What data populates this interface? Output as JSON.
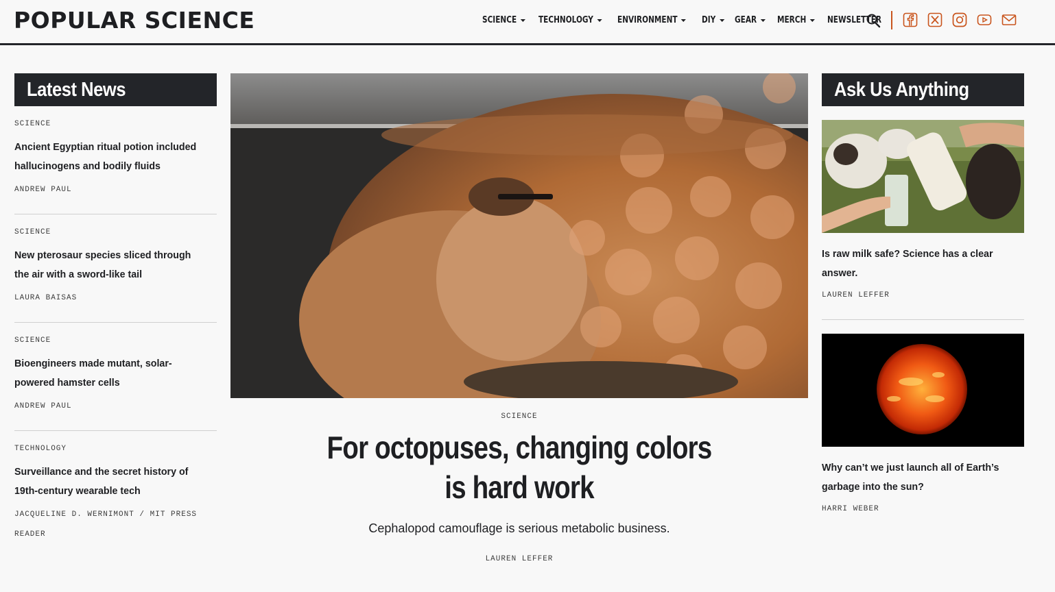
{
  "header": {
    "logo": "POPULAR SCIENCE",
    "nav": [
      {
        "label": "SCIENCE",
        "caret": true
      },
      {
        "label": "TECHNOLOGY",
        "caret": true
      },
      {
        "label": "ENVIRONMENT",
        "caret": true
      },
      {
        "label": "DIY",
        "caret": true
      },
      {
        "label": "GEAR",
        "caret": true
      },
      {
        "label": "MERCH",
        "caret": true
      },
      {
        "label": "NEWSLETTER",
        "caret": false
      }
    ],
    "icons": [
      "search-icon",
      "facebook-icon",
      "x-icon",
      "instagram-icon",
      "youtube-icon",
      "mail-icon"
    ],
    "accent": "#c9541c"
  },
  "latest": {
    "title": "Latest News",
    "items": [
      {
        "category": "SCIENCE",
        "headline": "Ancient Egyptian ritual potion included hallucinogens and bodily fluids",
        "author": "ANDREW PAUL"
      },
      {
        "category": "SCIENCE",
        "headline": "New pterosaur species sliced through the air with a sword-like tail",
        "author": "LAURA BAISAS"
      },
      {
        "category": "SCIENCE",
        "headline": "Bioengineers made mutant, solar-powered hamster cells",
        "author": "ANDREW PAUL"
      },
      {
        "category": "TECHNOLOGY",
        "headline": "Surveillance and the secret history of 19th-century wearable tech",
        "author": "JACQUELINE D. WERNIMONT / MIT PRESS READER"
      }
    ]
  },
  "feature": {
    "category": "SCIENCE",
    "headline": "For octopuses, changing colors is hard work",
    "dek": "Cephalopod camouflage is serious metabolic business.",
    "author": "LAUREN LEFFER"
  },
  "ask": {
    "title": "Ask Us Anything",
    "items": [
      {
        "headline": "Is raw milk safe? Science has a clear answer.",
        "author": "LAUREN LEFFER"
      },
      {
        "headline": "Why can’t we just launch all of Earth’s garbage into the sun?",
        "author": "HARRI WEBER"
      }
    ]
  }
}
